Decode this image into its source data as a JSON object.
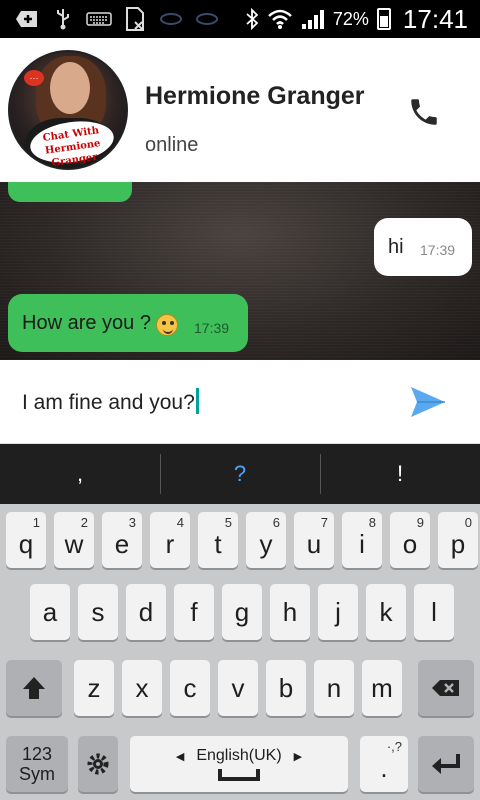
{
  "status_bar": {
    "icons": [
      "add-icon",
      "usb-icon",
      "keyboard-icon",
      "sim-off-icon",
      "app-icon-1",
      "app-icon-2",
      "bluetooth-icon",
      "wifi-icon",
      "signal-icon"
    ],
    "battery": "72%",
    "time": "17:41"
  },
  "header": {
    "contact_name": "Hermione Granger",
    "status": "online",
    "avatar_logo_text": "Chat With Hermione Granger"
  },
  "messages": [
    {
      "direction": "out",
      "text": "hi",
      "time": "17:39"
    },
    {
      "direction": "in",
      "text": "How are you ?",
      "time": "17:39",
      "emoji": "smile-emoji"
    }
  ],
  "compose": {
    "value": "I am fine and you?"
  },
  "suggestions": [
    ",",
    "?",
    "!"
  ],
  "keyboard": {
    "row1": [
      {
        "k": "q",
        "h": "1"
      },
      {
        "k": "w",
        "h": "2"
      },
      {
        "k": "e",
        "h": "3"
      },
      {
        "k": "r",
        "h": "4"
      },
      {
        "k": "t",
        "h": "5"
      },
      {
        "k": "y",
        "h": "6"
      },
      {
        "k": "u",
        "h": "7"
      },
      {
        "k": "i",
        "h": "8"
      },
      {
        "k": "o",
        "h": "9"
      },
      {
        "k": "p",
        "h": "0"
      }
    ],
    "row2": [
      "a",
      "s",
      "d",
      "f",
      "g",
      "h",
      "j",
      "k",
      "l"
    ],
    "row3": [
      "z",
      "x",
      "c",
      "v",
      "b",
      "n",
      "m"
    ],
    "sym_label_1": "123",
    "sym_label_2": "Sym",
    "space_label": "English(UK)",
    "period_label": ".",
    "period_hint": "·,?"
  }
}
